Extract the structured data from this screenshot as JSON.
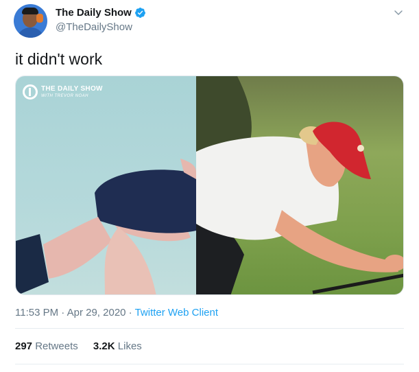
{
  "author": {
    "display_name": "The Daily Show",
    "handle": "@TheDailyShow",
    "verified": true,
    "avatar_icon": "avatar-photo"
  },
  "tweet": {
    "text": "it didn't work"
  },
  "media": {
    "watermark_title": "THE DAILY SHOW",
    "watermark_subtitle": "WITH TREVOR NOAH"
  },
  "meta": {
    "time": "11:53 PM",
    "date": "Apr 29, 2020",
    "separator": " · ",
    "source": "Twitter Web Client"
  },
  "stats": {
    "retweets_count": "297",
    "retweets_label": "Retweets",
    "likes_count": "3.2K",
    "likes_label": "Likes"
  },
  "colors": {
    "link": "#1da1f2",
    "secondary_text": "#657786",
    "primary_text": "#14171a"
  }
}
